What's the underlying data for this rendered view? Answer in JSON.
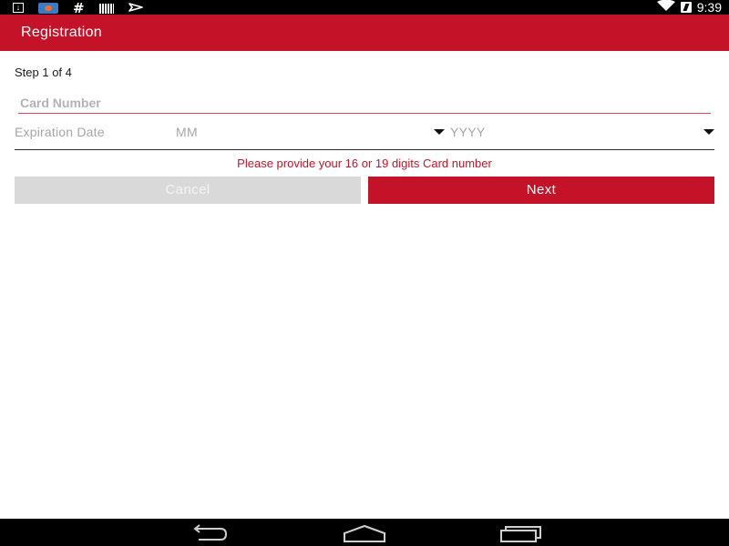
{
  "status_bar": {
    "time": "9:39",
    "notification_icons": [
      "download-icon",
      "game-icon",
      "hash-icon",
      "barcode-icon",
      "airplane-icon"
    ],
    "system_icons": [
      "wifi-icon",
      "battery-charging-icon"
    ]
  },
  "app_bar": {
    "title": "Registration",
    "color": "#c41328"
  },
  "form": {
    "step_label": "Step 1 of 4",
    "card_number": {
      "value": "",
      "placeholder": "Card Number"
    },
    "expiration": {
      "label": "Expiration Date",
      "month_value": "MM",
      "year_value": "YYYY"
    },
    "error_message": "Please provide your 16 or 19 digits Card number"
  },
  "buttons": {
    "cancel_label": "Cancel",
    "next_label": "Next"
  },
  "nav_bar": {
    "icons": [
      "back-icon",
      "home-icon",
      "recents-icon"
    ]
  },
  "colors": {
    "accent": "#c41328",
    "error_text": "#c41328",
    "disabled_button": "#d9d9d9"
  }
}
